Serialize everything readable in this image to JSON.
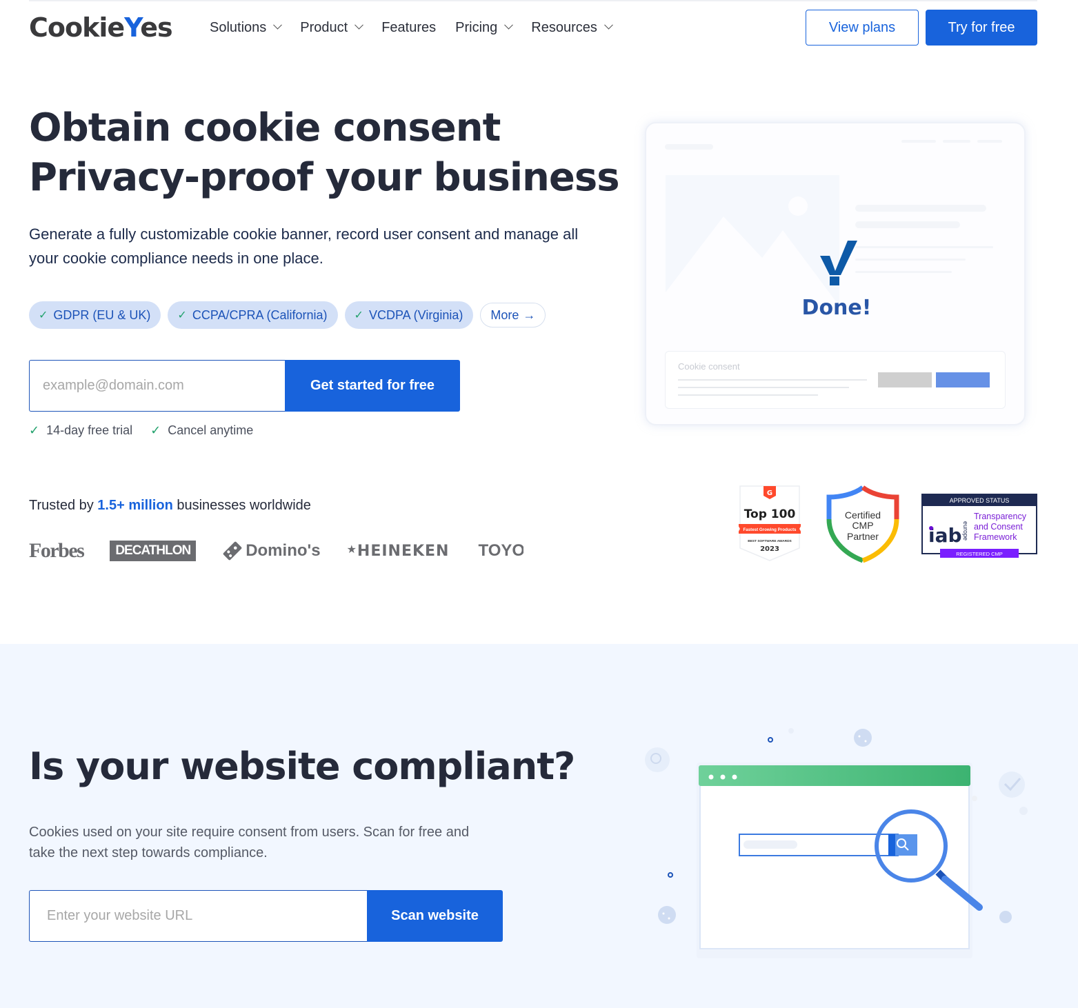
{
  "nav": {
    "logo": {
      "part1": "Cookie",
      "part2": "Y",
      "part3": "es"
    },
    "items": [
      {
        "label": "Solutions",
        "has_dropdown": true
      },
      {
        "label": "Product",
        "has_dropdown": true
      },
      {
        "label": "Features",
        "has_dropdown": false
      },
      {
        "label": "Pricing",
        "has_dropdown": true
      },
      {
        "label": "Resources",
        "has_dropdown": true
      }
    ],
    "view_plans_label": "View plans",
    "try_free_label": "Try for free"
  },
  "hero": {
    "title_line1": "Obtain cookie consent",
    "title_line2": "Privacy-proof your business",
    "subtitle": "Generate a fully customizable cookie banner, record user consent and manage all your cookie compliance needs in one place.",
    "chips": [
      {
        "label": "GDPR (EU & UK)"
      },
      {
        "label": "CCPA/CPRA (California)"
      },
      {
        "label": "VCDPA (Virginia)"
      }
    ],
    "more_label": "More",
    "email_placeholder": "example@domain.com",
    "email_value": "",
    "cta_label": "Get started for free",
    "perks": [
      "14-day free trial",
      "Cancel anytime"
    ],
    "illustration": {
      "done_label": "Done!",
      "consent_label": "Cookie consent"
    }
  },
  "trusted": {
    "prefix": "Trusted by ",
    "highlight": "1.5+ million",
    "suffix": " businesses worldwide",
    "brands": [
      "Forbes",
      "DECATHLON",
      "Domino's",
      "HEINEKEN",
      "TOYOTA"
    ]
  },
  "badges": {
    "g2": {
      "title": "Top 100",
      "ribbon": "Fastest Growing Products",
      "sub": "BEST SOFTWARE AWARDS",
      "year": "2023"
    },
    "cmp": {
      "line1": "Certified",
      "line2": "CMP",
      "line3": "Partner"
    },
    "iab": {
      "header": "APPROVED STATUS",
      "logo": "iab",
      "region": "europe",
      "line1": "Transparency",
      "line2": "and Consent",
      "line3": "Framework",
      "footer": "REGISTERED CMP"
    }
  },
  "compliance": {
    "title": "Is your website compliant?",
    "subtitle": "Cookies used on your site require consent from users. Scan for free and take the next step towards compliance.",
    "url_placeholder": "Enter your website URL",
    "url_value": "",
    "scan_label": "Scan website"
  },
  "colors": {
    "brand_blue": "#1863dc",
    "chip_bg": "#d3e0f7",
    "check_green": "#23a26d",
    "section_bg": "#f2f7ff"
  }
}
